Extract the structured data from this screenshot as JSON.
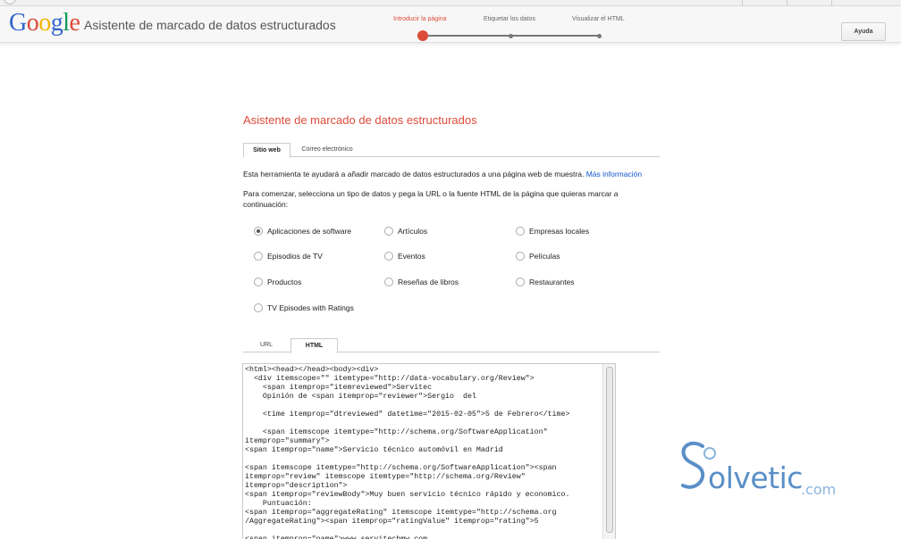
{
  "header": {
    "logo_letters": [
      {
        "ch": "G",
        "color": "#3366cc"
      },
      {
        "ch": "o",
        "color": "#dd4b39"
      },
      {
        "ch": "o",
        "color": "#f4b400"
      },
      {
        "ch": "g",
        "color": "#3366cc"
      },
      {
        "ch": "l",
        "color": "#0f9d58"
      },
      {
        "ch": "e",
        "color": "#dd4b39"
      }
    ],
    "app_title": "Asistente de marcado de datos estructurados",
    "steps": [
      {
        "label": "Introducir la página",
        "active": true
      },
      {
        "label": "Etiquetar los datos",
        "active": false
      },
      {
        "label": "Visualizar el HTML",
        "active": false
      }
    ],
    "help_label": "Ayuda"
  },
  "main": {
    "title": "Asistente de marcado de datos estructurados",
    "tabs": [
      {
        "label": "Sitio web",
        "active": true
      },
      {
        "label": "Correo electrónico",
        "active": false
      }
    ],
    "intro_text": "Esta herramienta te ayudará a añadir marcado de datos estructurados a una página web de muestra.",
    "intro_link": "Más información",
    "instruction_line1": "Para comenzar, selecciona un tipo de datos y pega la URL o la fuente HTML de la página que quieras marcar a",
    "instruction_line2": "continuación:",
    "data_types": [
      {
        "label": "Aplicaciones de software",
        "checked": true
      },
      {
        "label": "Artículos",
        "checked": false
      },
      {
        "label": "Empresas locales",
        "checked": false
      },
      {
        "label": "Episodios de TV",
        "checked": false
      },
      {
        "label": "Eventos",
        "checked": false
      },
      {
        "label": "Películas",
        "checked": false
      },
      {
        "label": "Productos",
        "checked": false
      },
      {
        "label": "Reseñas de libros",
        "checked": false
      },
      {
        "label": "Restaurantes",
        "checked": false
      },
      {
        "label": "TV Episodes with Ratings",
        "checked": false
      }
    ],
    "source_tabs": [
      {
        "label": "URL",
        "active": false
      },
      {
        "label": "HTML",
        "active": true
      }
    ],
    "html_source": "<html><head></head><body><div>\n  <div itemscope=\"\" itemtype=\"http://data-vocabulary.org/Review\">\n    <span itemprop=\"itemreviewed\">Servitec\n    Opinión de <span itemprop=\"reviewer\">Sergio  del\n\n    <time itemprop=\"dtreviewed\" datetime=\"2015-02-05\">5 de Febrero</time>\n\n    <span itemscope itemtype=\"http://schema.org/SoftwareApplication\"\nitemprop=\"summary\">\n<span itemprop=\"name\">Servicio técnico automóvil en Madrid\n\n<span itemscope itemtype=\"http://schema.org/SoftwareApplication\"><span\nitemprop=\"review\" itemscope itemtype=\"http://schema.org/Review\"\nitemprop=\"description\">\n<span itemprop=\"reviewBody\">Muy buen servicio técnico rápido y economico.\n    Puntuación:\n<span itemprop=\"aggregateRating\" itemscope itemtype=\"http://schema.org\n/AggregateRating\"><span itemprop=\"ratingValue\" itemprop=\"rating\">5\n\n<span itemprop=\"name\">www.servitecbmw.com"
  },
  "watermark": {
    "word": "olvetic",
    "suffix": ".com",
    "color": "#5a8fc7"
  }
}
